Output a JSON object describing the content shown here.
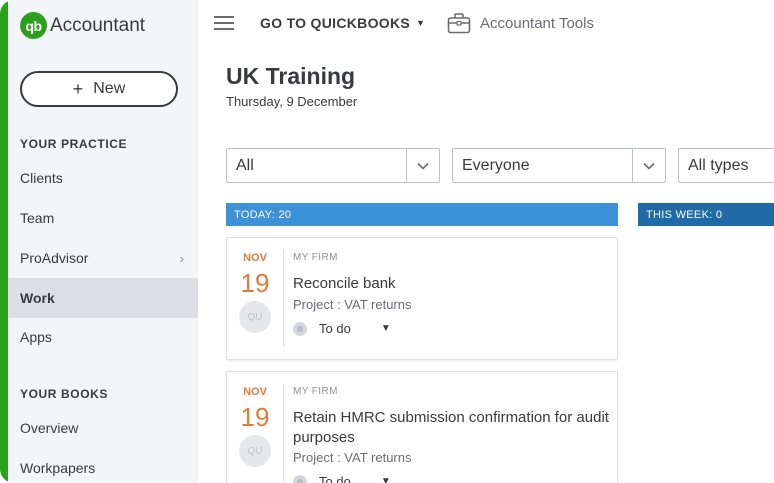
{
  "app": {
    "logo_mark": "qb",
    "logo_text": "Accountant"
  },
  "sidebar": {
    "new_label": "New",
    "practice_heading": "YOUR PRACTICE",
    "practice_items": [
      {
        "label": "Clients"
      },
      {
        "label": "Team"
      },
      {
        "label": "ProAdvisor",
        "has_submenu": true
      },
      {
        "label": "Work",
        "active": true
      },
      {
        "label": "Apps"
      }
    ],
    "books_heading": "YOUR BOOKS",
    "books_items": [
      {
        "label": "Overview"
      },
      {
        "label": "Workpapers"
      }
    ]
  },
  "topbar": {
    "goto_label": "GO TO QUICKBOOKS",
    "tools_label": "Accountant Tools"
  },
  "header": {
    "title": "UK Training",
    "date": "Thursday, 9 December"
  },
  "filters": {
    "status": "All",
    "assignee": "Everyone",
    "type": "All types"
  },
  "columns": {
    "today": "TODAY:  20",
    "this_week": "THIS WEEK:  0"
  },
  "tasks": [
    {
      "month": "NOV",
      "day": "19",
      "avatar": "QU",
      "firm": "MY FIRM",
      "title": "Reconcile bank",
      "project": "Project : VAT returns",
      "status": "To do"
    },
    {
      "month": "NOV",
      "day": "19",
      "avatar": "QU",
      "firm": "MY FIRM",
      "title": "Retain HMRC submission confirmation for audit purposes",
      "project": "Project : VAT returns",
      "status": "To do"
    }
  ],
  "colors": {
    "brand_green": "#2ca01c",
    "today_header": "#3d91d6",
    "week_header": "#1f6ba8",
    "date_accent": "#e07b39"
  }
}
